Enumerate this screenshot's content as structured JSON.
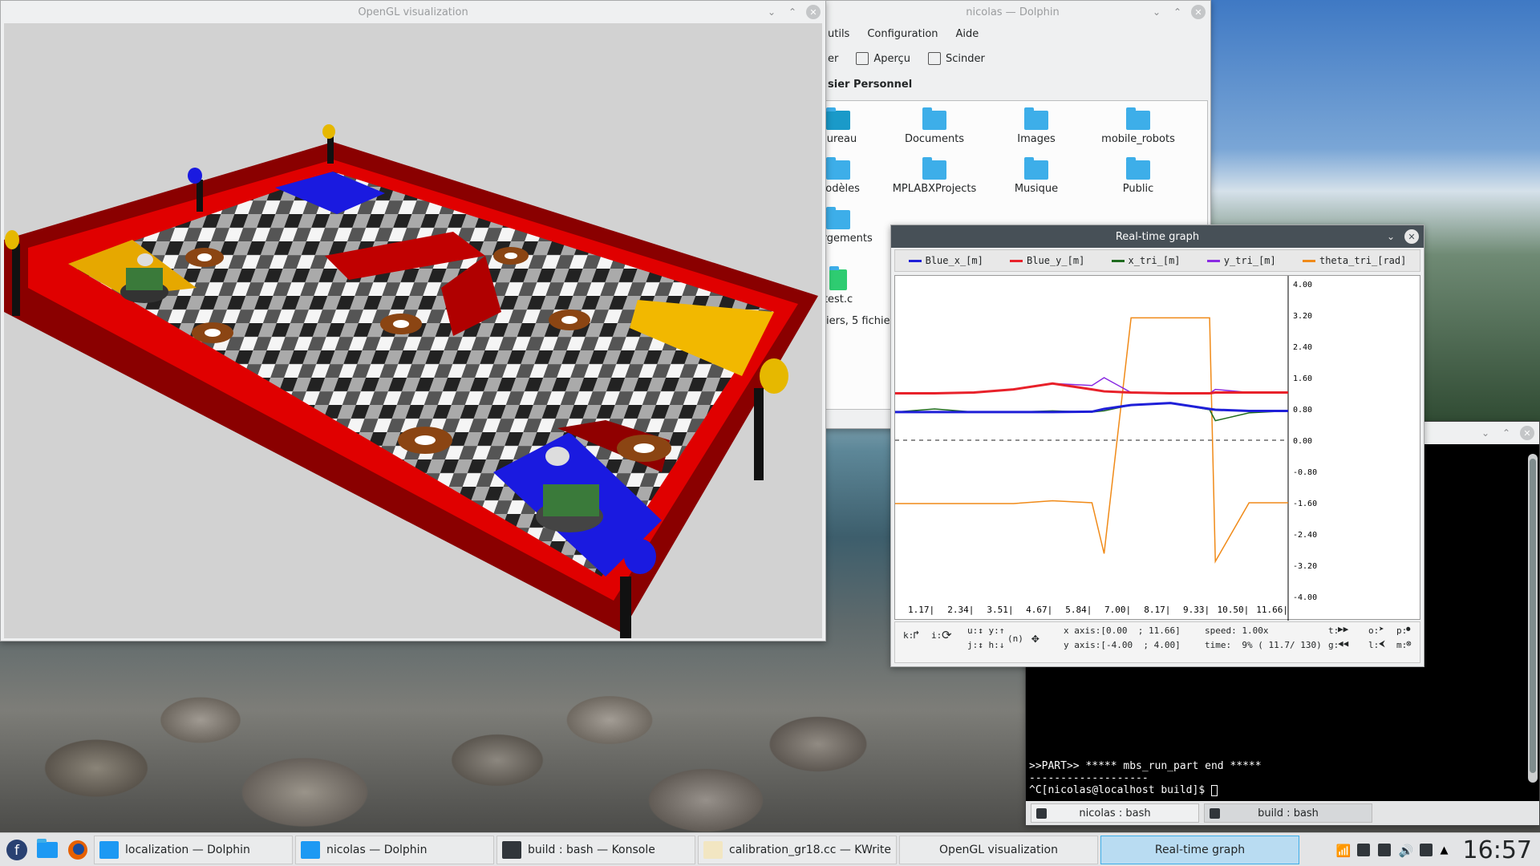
{
  "opengl": {
    "title": "OpenGL visualization"
  },
  "dolphin": {
    "title": "nicolas — Dolphin",
    "menu": [
      "utils",
      "Configuration",
      "Aide"
    ],
    "toolbar": [
      "er",
      "Aperçu",
      "Scinder"
    ],
    "location": "sier Personnel",
    "files": [
      "Bureau",
      "Documents",
      "Images",
      "mobile_robots",
      "Modèles",
      "MPLABXProjects",
      "Musique",
      "Public",
      "chargements",
      "test.c"
    ],
    "status": "iers, 5 fichie"
  },
  "graph": {
    "title": "Real-time graph",
    "legend": [
      {
        "label": "Blue_x_[m]",
        "color": "#1f1fd8"
      },
      {
        "label": "Blue_y_[m]",
        "color": "#e8212a"
      },
      {
        "label": "x_tri_[m]",
        "color": "#1f6b1f"
      },
      {
        "label": "y_tri_[m]",
        "color": "#8a2be2"
      },
      {
        "label": "theta_tri_[rad]",
        "color": "#f08a18"
      }
    ],
    "y_ticks": [
      "4.00",
      "3.20",
      "2.40",
      "1.60",
      "0.80",
      "0.00",
      "-0.80",
      "-1.60",
      "-2.40",
      "-3.20",
      "-4.00"
    ],
    "x_ticks": [
      "1.17|",
      "2.34|",
      "3.51|",
      "4.67|",
      "5.84|",
      "7.00|",
      "8.17|",
      "9.33|",
      "10.50|",
      "11.66|"
    ],
    "status": {
      "k": "k:",
      "i": "i:",
      "uy": "u:↕ y:↑",
      "jh": "j:↕ h:↓",
      "n": "(n)",
      "xaxis": "x axis:[0.00  ; 11.66]",
      "yaxis": "y axis:[-4.00  ; 4.00]",
      "speed": "speed: 1.00x",
      "time": "time:  9% ( 11.7/ 130)",
      "t": "t:",
      "g": "g:",
      "o": "o:",
      "l": "l:",
      "p": "p:",
      "m": "m:"
    }
  },
  "chart_data": {
    "type": "line",
    "title": "",
    "xlabel": "",
    "ylabel": "",
    "xlim": [
      0,
      11.66
    ],
    "ylim": [
      -4.0,
      4.0
    ],
    "x": [
      0,
      1.17,
      2.34,
      3.51,
      4.67,
      5.84,
      6.2,
      7.0,
      8.17,
      9.33,
      9.5,
      10.5,
      11.66
    ],
    "series": [
      {
        "name": "Blue_x_[m]",
        "values": [
          0.72,
          0.72,
          0.72,
          0.72,
          0.72,
          0.73,
          0.8,
          0.9,
          0.95,
          0.8,
          0.78,
          0.75,
          0.75
        ]
      },
      {
        "name": "Blue_y_[m]",
        "values": [
          1.2,
          1.2,
          1.22,
          1.3,
          1.45,
          1.3,
          1.25,
          1.22,
          1.2,
          1.2,
          1.22,
          1.22,
          1.22
        ]
      },
      {
        "name": "x_tri_[m]",
        "values": [
          0.72,
          0.8,
          0.72,
          0.72,
          0.75,
          0.72,
          0.75,
          0.9,
          0.95,
          0.78,
          0.5,
          0.7,
          0.75
        ]
      },
      {
        "name": "y_tri_[m]",
        "values": [
          1.2,
          1.2,
          1.22,
          1.3,
          1.45,
          1.4,
          1.6,
          1.22,
          1.2,
          1.2,
          1.3,
          1.22,
          1.22
        ]
      },
      {
        "name": "theta_tri_[rad]",
        "values": [
          -1.62,
          -1.62,
          -1.62,
          -1.62,
          -1.55,
          -1.6,
          -2.9,
          3.13,
          3.13,
          3.13,
          -3.1,
          -1.6,
          -1.6
        ]
      }
    ],
    "grid": false,
    "legend": "top"
  },
  "konsole": {
    "lines": [
      ">>PART>> ***** mbs_run_part end *****",
      "-------------------",
      "^C[nicolas@localhost build]$ "
    ],
    "tabs": [
      "nicolas : bash",
      "build : bash"
    ]
  },
  "taskbar": {
    "tasks": [
      {
        "label": "localization — Dolphin",
        "icon": "dolphin-icon"
      },
      {
        "label": "nicolas — Dolphin",
        "icon": "dolphin-icon"
      },
      {
        "label": "build : bash — Konsole",
        "icon": "konsole-icon"
      },
      {
        "label": "calibration_gr18.cc  — KWrite",
        "icon": "kwrite-icon"
      },
      {
        "label": "OpenGL visualization",
        "icon": ""
      },
      {
        "label": "Real-time graph",
        "icon": ""
      }
    ],
    "clock": "16:57"
  }
}
